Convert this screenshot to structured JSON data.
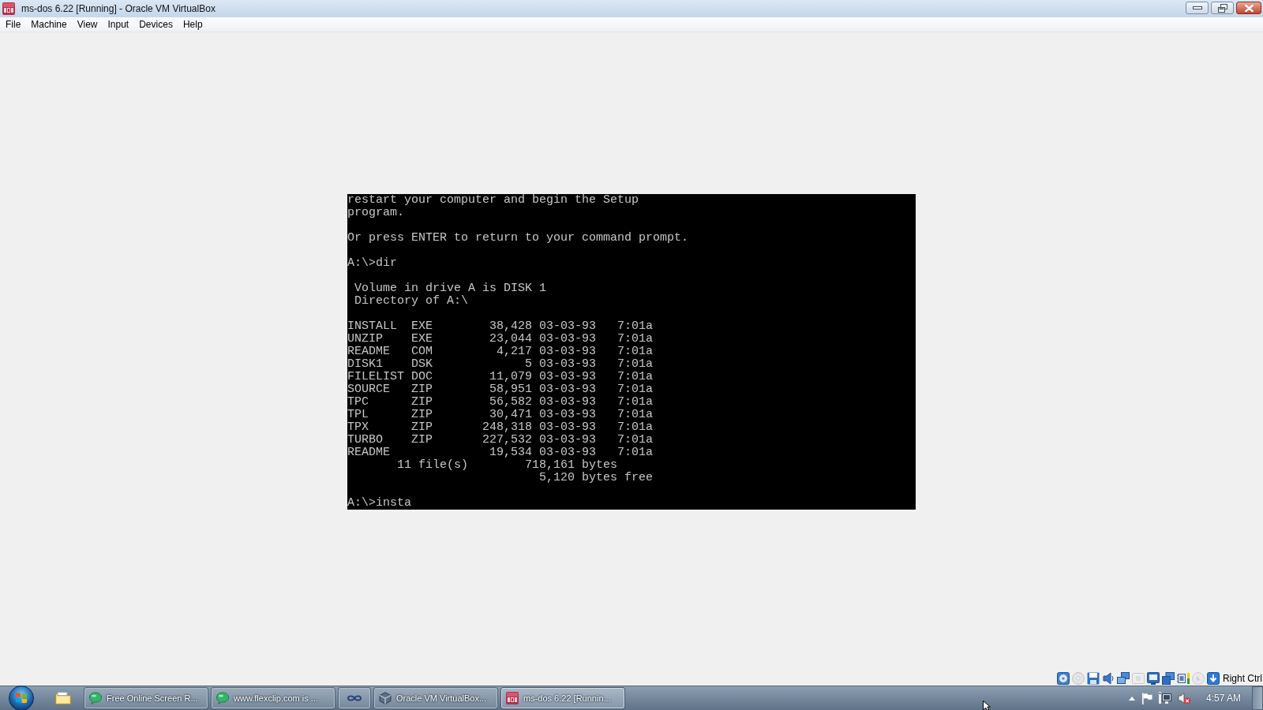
{
  "window": {
    "title": "ms-dos 6.22 [Running] - Oracle VM VirtualBox"
  },
  "menu": [
    "File",
    "Machine",
    "View",
    "Input",
    "Devices",
    "Help"
  ],
  "console": {
    "blocks": [
      [
        "restart your computer and begin the Setup",
        "program."
      ],
      [
        "Or press ENTER to return to your command prompt."
      ],
      [
        "A:\\>dir"
      ],
      [
        " Volume in drive A is DISK 1",
        " Directory of A:\\"
      ],
      [
        "INSTALL  EXE        38,428 03-03-93   7:01a",
        "UNZIP    EXE        23,044 03-03-93   7:01a",
        "README   COM         4,217 03-03-93   7:01a",
        "DISK1    DSK             5 03-03-93   7:01a",
        "FILELIST DOC        11,079 03-03-93   7:01a",
        "SOURCE   ZIP        58,951 03-03-93   7:01a",
        "TPC      ZIP        56,582 03-03-93   7:01a",
        "TPL      ZIP        30,471 03-03-93   7:01a",
        "TPX      ZIP       248,318 03-03-93   7:01a",
        "TURBO    ZIP       227,532 03-03-93   7:01a",
        "README              19,534 03-03-93   7:01a",
        "       11 file(s)        718,161 bytes",
        "                           5,120 bytes free"
      ],
      [
        "A:\\>insta"
      ]
    ]
  },
  "status_bar": {
    "host_key": "Right Ctrl"
  },
  "taskbar": {
    "buttons": [
      {
        "label": "Free Online Screen R...",
        "selected": false
      },
      {
        "label": "www.flexclip.com is ...",
        "selected": false
      },
      {
        "selected": false
      },
      {
        "label": "Oracle VM VirtualBox...",
        "selected": false
      },
      {
        "label": "ms-dos 6.22 [Runnin...",
        "selected": true
      }
    ],
    "tray": {
      "volume_muted": true,
      "time": "4:57 AM"
    }
  }
}
